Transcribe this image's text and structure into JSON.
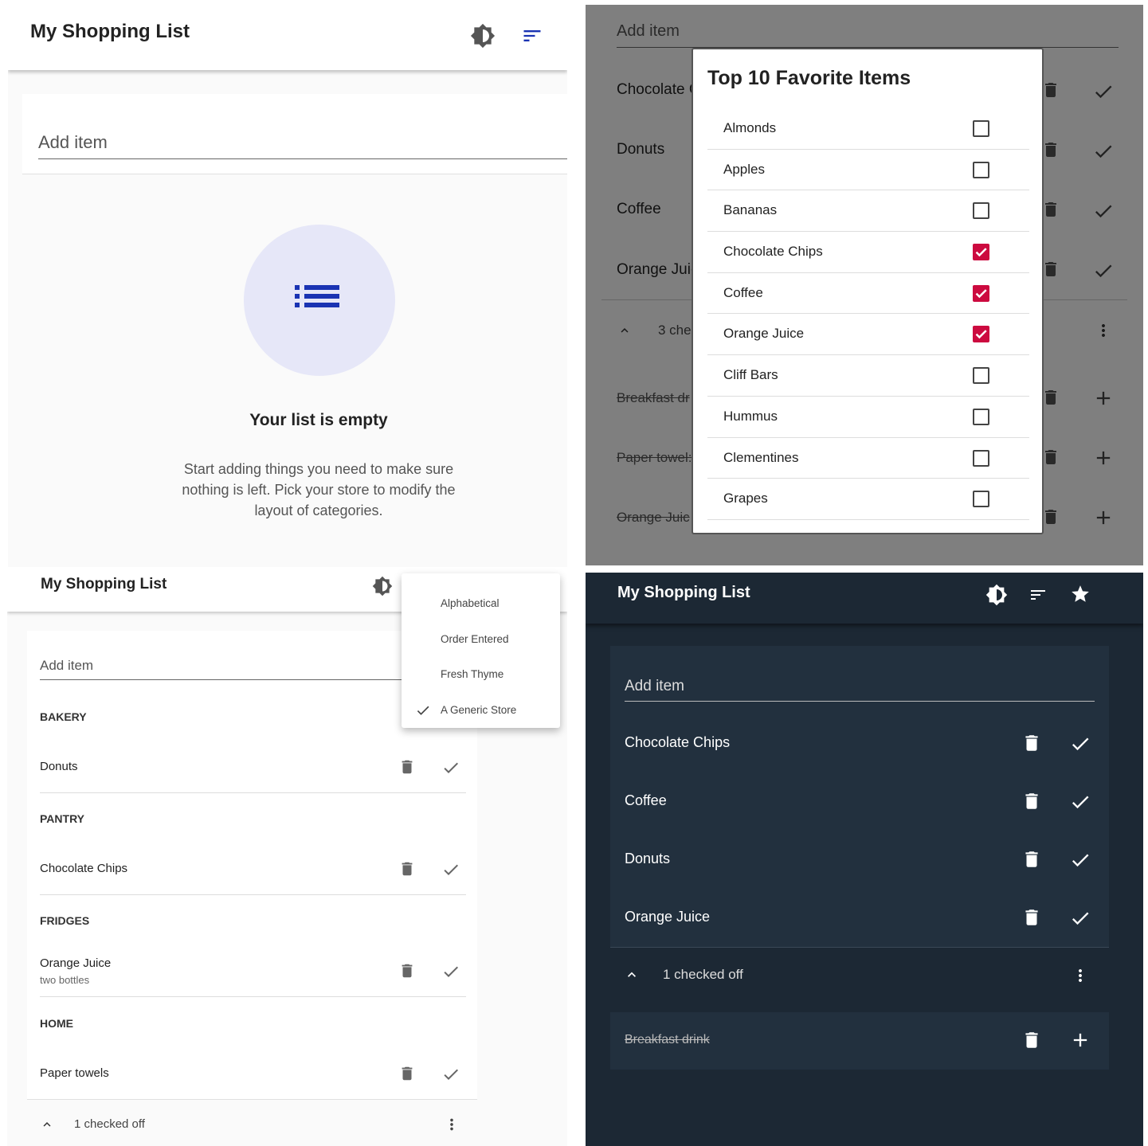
{
  "colors": {
    "accent_blue": "#1a33b3",
    "checkbox_red": "#cc0a3f",
    "dark_bg": "#1c2834"
  },
  "panel_a": {
    "title": "My Shopping List",
    "add_placeholder": "Add item",
    "empty_title": "Your list is empty",
    "empty_desc": "Start adding things you need to make sure nothing is left. Pick your store to modify the layout of categories."
  },
  "panel_b": {
    "add_placeholder": "Add item",
    "background_items": [
      "Chocolate C",
      "Donuts",
      "Coffee",
      "Orange Juic"
    ],
    "checked_count": "3 che",
    "checked_items": [
      "Breakfast dr",
      "Paper towel:",
      "Orange Juic"
    ],
    "dialog_title": "Top 10 Favorite Items",
    "favorites": [
      {
        "label": "Almonds",
        "checked": false
      },
      {
        "label": "Apples",
        "checked": false
      },
      {
        "label": "Bananas",
        "checked": false
      },
      {
        "label": "Chocolate Chips",
        "checked": true
      },
      {
        "label": "Coffee",
        "checked": true
      },
      {
        "label": "Orange Juice",
        "checked": true
      },
      {
        "label": "Cliff Bars",
        "checked": false
      },
      {
        "label": "Hummus",
        "checked": false
      },
      {
        "label": "Clementines",
        "checked": false
      },
      {
        "label": "Grapes",
        "checked": false
      }
    ]
  },
  "panel_c": {
    "title": "My Shopping List",
    "add_placeholder": "Add item",
    "categories": [
      "BAKERY",
      "PANTRY",
      "FRIDGES",
      "HOME"
    ],
    "items": [
      "Donuts",
      "Chocolate Chips",
      "Orange Juice",
      "Paper towels"
    ],
    "orange_juice_note": "two bottles",
    "checked_off": "1 checked off",
    "sort_menu": [
      "Alphabetical",
      "Order Entered",
      "Fresh Thyme",
      "A Generic Store"
    ],
    "sort_selected": "A Generic Store"
  },
  "panel_d": {
    "title": "My Shopping List",
    "add_placeholder": "Add item",
    "items": [
      "Chocolate Chips",
      "Coffee",
      "Donuts",
      "Orange Juice"
    ],
    "checked_off": "1 checked off",
    "checked_items": [
      "Breakfast drink"
    ]
  }
}
